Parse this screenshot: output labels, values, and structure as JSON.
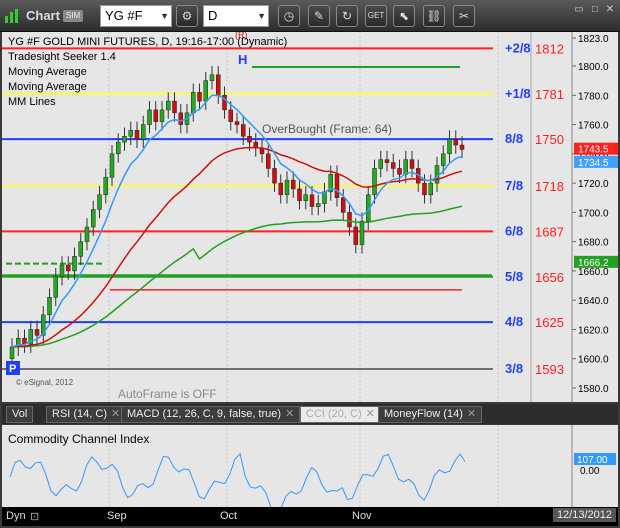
{
  "window": {
    "title": "Chart",
    "badge": "SIM",
    "symbol": "YG #F",
    "interval": "D",
    "toolbar_icons": [
      "settings-icon",
      "clock-icon",
      "draw-icon",
      "refresh-icon",
      "get-icon",
      "link-icon"
    ]
  },
  "chart": {
    "header": "YG #F GOLD MINI FUTURES, D, 19:16-17:00 (Dynamic)",
    "studies": [
      "Tradesight Seeker 1.4",
      "Moving Average",
      "Moving Average",
      "MM Lines"
    ],
    "marker_h": "H",
    "marker_r": "(R)",
    "marker_p": "P",
    "overbought_note": "OverBought (Frame: 64)",
    "autoframe_note": "AutoFrame is OFF",
    "copyright": "© eSignal, 2012",
    "colors": {
      "red_line": "#ff2020",
      "blue_line": "#1f3fff",
      "yellow_line": "#ffff40",
      "green_line": "#22a022",
      "gray_line": "#707070",
      "candle_up": "#22aa22",
      "candle_down": "#cc1010"
    }
  },
  "mm_lines": [
    {
      "label": "+2/8",
      "price": "1812",
      "color": "#ff2020"
    },
    {
      "label": "+1/8",
      "price": "1781",
      "color": "#ffff40"
    },
    {
      "label": "8/8",
      "price": "1750",
      "color": "#1f3fff"
    },
    {
      "label": "7/8",
      "price": "1718",
      "color": "#ffff40"
    },
    {
      "label": "6/8",
      "price": "1687",
      "color": "#ff2020"
    },
    {
      "label": "5/8",
      "price": "1656",
      "color": "#22a022"
    },
    {
      "label": "4/8",
      "price": "1625",
      "color": "#1f3fff"
    },
    {
      "label": "3/8",
      "price": "1593",
      "color": "#707070"
    }
  ],
  "price_axis": {
    "ticks": [
      "1823.0",
      "1800.0",
      "1780.0",
      "1760.0",
      "1740.0",
      "1720.0",
      "1700.0",
      "1680.0",
      "1660.0",
      "1640.0",
      "1620.0",
      "1600.0",
      "1580.0"
    ],
    "badges": [
      {
        "value": "1743.5",
        "color": "#ff2020"
      },
      {
        "value": "1734.5",
        "color": "#3fa0ff"
      },
      {
        "value": "1666.2",
        "color": "#22a022"
      }
    ]
  },
  "tabs": [
    {
      "label": "Vol"
    },
    {
      "label": "RSI (14, C)"
    },
    {
      "label": "MACD (12, 26, C, 9, false, true)"
    },
    {
      "label": "CCI (20, C)"
    },
    {
      "label": "MoneyFlow (14)"
    }
  ],
  "cci": {
    "title": "Commodity Channel Index",
    "badge": "107.00",
    "zero": "0.00"
  },
  "date_axis": {
    "dyn": "Dyn",
    "months": [
      "Sep",
      "Oct",
      "Nov"
    ],
    "last_date": "12/13/2012"
  }
}
